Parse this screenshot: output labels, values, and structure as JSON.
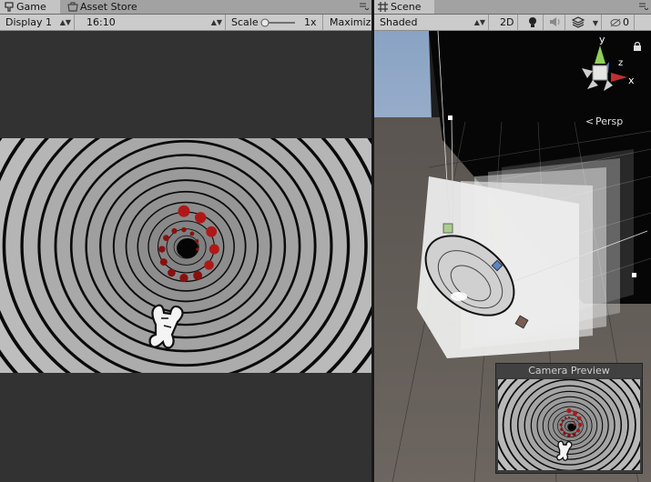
{
  "game": {
    "tab_label": "Game",
    "tab2_label": "Asset Store",
    "display": "Display 1",
    "aspect": "16:10",
    "scale_label": "Scale",
    "scale_value": "1x",
    "maximize": "Maximize"
  },
  "scene": {
    "tab_label": "Scene",
    "shading": "Shaded",
    "mode_2d": "2D",
    "hidden_count": "0",
    "gizmo_y": "y",
    "gizmo_z": "z",
    "gizmo_x": "x",
    "projection": "Persp",
    "preview_title": "Camera Preview"
  },
  "icons": [
    "game-tab-icon",
    "asset-store-icon",
    "scene-tab-icon",
    "light-icon",
    "audio-icon",
    "effects-icon",
    "hidden-objects-icon",
    "lock-icon",
    "panel-menu-icon",
    "scale-slider-icon"
  ]
}
